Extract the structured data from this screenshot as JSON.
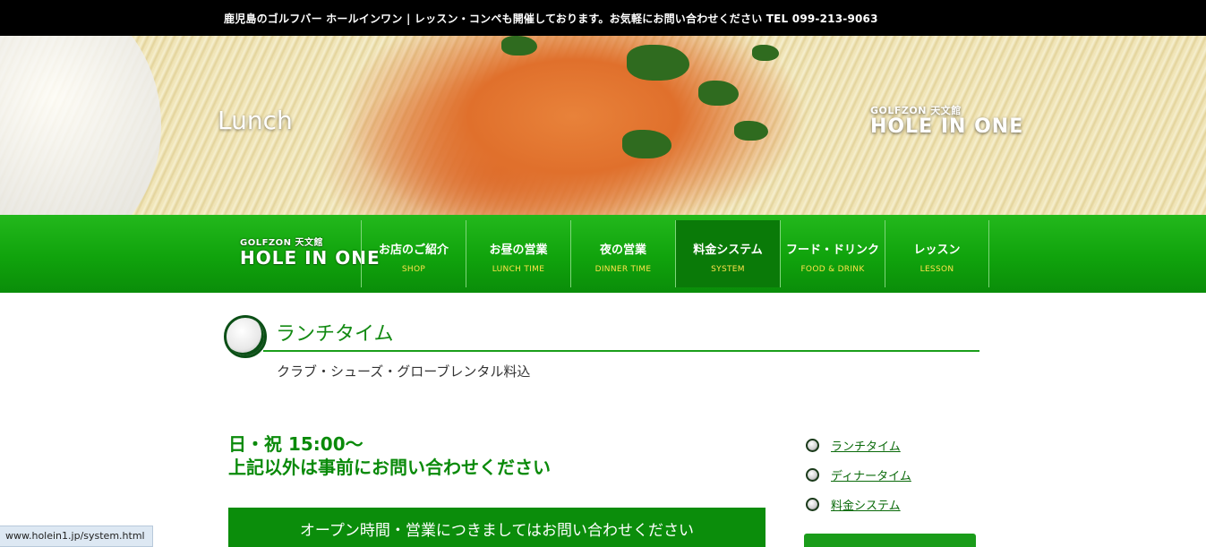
{
  "topbar": {
    "text": "鹿児島のゴルフバー ホールインワン | レッスン・コンペも開催しております。お気軽にお問い合わせください TEL 099-213-9063"
  },
  "hero": {
    "title": "Lunch",
    "logo_small": "GOLFZON 天文館",
    "logo_big": "HOLE IN ONE"
  },
  "nav": {
    "logo_small": "GOLFZON 天文館",
    "logo_big": "HOLE IN ONE",
    "items": [
      {
        "jp": "お店のご紹介",
        "en": "SHOP"
      },
      {
        "jp": "お昼の営業",
        "en": "LUNCH TIME"
      },
      {
        "jp": "夜の営業",
        "en": "DINNER TIME"
      },
      {
        "jp": "料金システム",
        "en": "SYSTEM"
      },
      {
        "jp": "フード・ドリンク",
        "en": "FOOD & DRINK"
      },
      {
        "jp": "レッスン",
        "en": "LESSON"
      }
    ],
    "active_index": 3
  },
  "main": {
    "heading": "ランチタイム",
    "subtitle": "クラブ・シューズ・グローブレンタル料込",
    "hours_line1": "日・祝 15:00〜",
    "hours_line2": "上記以外は事前にお問い合わせください",
    "banner": "オープン時間・営業につきましてはお問い合わせください"
  },
  "sidebar": {
    "links": [
      {
        "label": "ランチタイム"
      },
      {
        "label": "ディナータイム"
      },
      {
        "label": "料金システム"
      }
    ]
  },
  "status": {
    "url": "www.holein1.jp/system.html"
  },
  "colors": {
    "accent_green": "#10a30c",
    "nav_en_text": "#ffe14a",
    "heading_green": "#138a13"
  }
}
